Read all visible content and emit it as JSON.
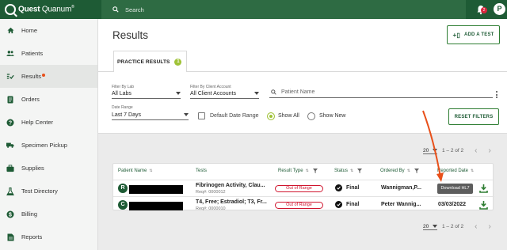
{
  "brand": {
    "name_bold": "Quest",
    "name_light": " Quanum",
    "trademark": "®"
  },
  "search": {
    "placeholder": "Search"
  },
  "notifications": {
    "count": "2"
  },
  "user": {
    "initial": "P"
  },
  "sidebar": {
    "items": [
      {
        "label": "Home",
        "icon": "home-icon"
      },
      {
        "label": "Patients",
        "icon": "patients-icon"
      },
      {
        "label": "Results",
        "icon": "results-icon",
        "active": true,
        "has_dot": true
      },
      {
        "label": "Orders",
        "icon": "orders-icon"
      },
      {
        "label": "Help Center",
        "icon": "help-icon"
      },
      {
        "label": "Specimen Pickup",
        "icon": "truck-icon"
      },
      {
        "label": "Supplies",
        "icon": "briefcase-icon"
      },
      {
        "label": "Test Directory",
        "icon": "flask-icon"
      },
      {
        "label": "Billing",
        "icon": "dollar-icon"
      },
      {
        "label": "Reports",
        "icon": "reports-icon"
      }
    ]
  },
  "page": {
    "title": "Results",
    "add_test_label": "ADD A TEST",
    "tab_label": "PRACTICE RESULTS",
    "tab_count": "1"
  },
  "filters": {
    "lab_label": "Filter By Lab",
    "lab_value": "All Labs",
    "account_label": "Filter By Client Account",
    "account_value": "All Client Accounts",
    "patient_placeholder": "Patient Name",
    "date_range_label": "Date Range",
    "date_range_value": "Last 7 Days",
    "default_date_label": "Default Date Range",
    "show_all_label": "Show All",
    "show_new_label": "Show New",
    "reset_label": "RESET FILTERS"
  },
  "pagination": {
    "per_page": "20",
    "range": "1 – 2 of 2"
  },
  "table": {
    "headers": {
      "patient": "Patient Name",
      "tests": "Tests",
      "result_type": "Result Type",
      "status": "Status",
      "ordered_by": "Ordered By",
      "reported_date": "Reported Date"
    },
    "rows": [
      {
        "initial": "R",
        "test": "Fibrinogen Activity, Clau...",
        "req": "Req#: 0000012",
        "result_type": "Out of Range",
        "status": "Final",
        "ordered_by": "Wannigman,P...",
        "date": "",
        "tooltip": "Download HL7"
      },
      {
        "initial": "C",
        "test": "T4, Free; Estradiol; T3, Fr...",
        "req": "Req#: 0000010",
        "result_type": "Out of Range",
        "status": "Final",
        "ordered_by": "Peter Wannig...",
        "date": "03/03/2022"
      }
    ]
  },
  "colors": {
    "brand_green": "#1e5b35",
    "accent_lime": "#9fc236",
    "alert_red": "#d0152e",
    "annotation_arrow": "#e8501a"
  }
}
